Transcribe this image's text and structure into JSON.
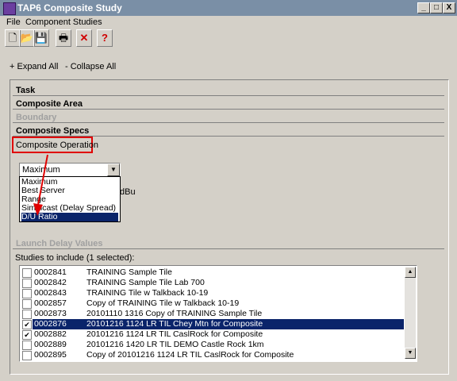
{
  "window": {
    "title": "TAP6 Composite Study",
    "min": "_",
    "max": "□",
    "close": "X"
  },
  "menu": {
    "items": [
      "File",
      "Component Studies"
    ]
  },
  "toolbar": {
    "buttons": [
      {
        "icon": "new-document-icon",
        "glyph": "🗋"
      },
      {
        "icon": "open-folder-icon",
        "glyph": "📂"
      },
      {
        "icon": "save-disk-icon",
        "glyph": "💾"
      },
      {
        "icon": "print-icon",
        "glyph": "🖶"
      },
      {
        "icon": "delete-x-icon",
        "glyph": "✕",
        "color": "#d00000"
      },
      {
        "icon": "help-icon",
        "glyph": "?",
        "color": "#d00000"
      }
    ]
  },
  "tree": {
    "expand_all": "+ Expand All",
    "collapse_all": "- Collapse All"
  },
  "sections": {
    "task": "Task",
    "composite_area": "Composite Area",
    "boundary": "Boundary",
    "composite_specs": "Composite Specs",
    "launch_delay": "Launch Delay Values"
  },
  "composite_operation": {
    "label": "Composite Operation",
    "selected": "Maximum",
    "options": [
      "Maximum",
      "Best Server",
      "Range",
      "Simulcast (Delay Spread)",
      "D/U Ratio"
    ],
    "highlighted": "D/U Ratio",
    "hidden_fragment": "dBu"
  },
  "studies": {
    "label": "Studies to include (1 selected):",
    "rows": [
      {
        "id": "0002841",
        "name": "TRAINING Sample Tile",
        "checked": false,
        "selected": false
      },
      {
        "id": "0002842",
        "name": "TRAINING Sample Tile Lab 700",
        "checked": false,
        "selected": false
      },
      {
        "id": "0002843",
        "name": "TRAINING Tile w Talkback 10-19",
        "checked": false,
        "selected": false
      },
      {
        "id": "0002857",
        "name": "Copy of TRAINING Tile w Talkback 10-19",
        "checked": false,
        "selected": false
      },
      {
        "id": "0002873",
        "name": "20101110 1316 Copy of TRAINING Sample Tile",
        "checked": false,
        "selected": false
      },
      {
        "id": "0002876",
        "name": "20101216 1124 LR TIL Chey Mtn for Composite",
        "checked": true,
        "selected": true
      },
      {
        "id": "0002882",
        "name": "20101216 1124 LR TIL CaslRock for Composite",
        "checked": true,
        "selected": false
      },
      {
        "id": "0002889",
        "name": "20101216 1420 LR TIL DEMO Castle Rock 1km",
        "checked": false,
        "selected": false
      },
      {
        "id": "0002895",
        "name": "Copy of 20101216 1124 LR TIL CaslRock for Composite",
        "checked": false,
        "selected": false
      }
    ]
  },
  "colors": {
    "selection": "#0a246a",
    "callout": "#e00000"
  }
}
